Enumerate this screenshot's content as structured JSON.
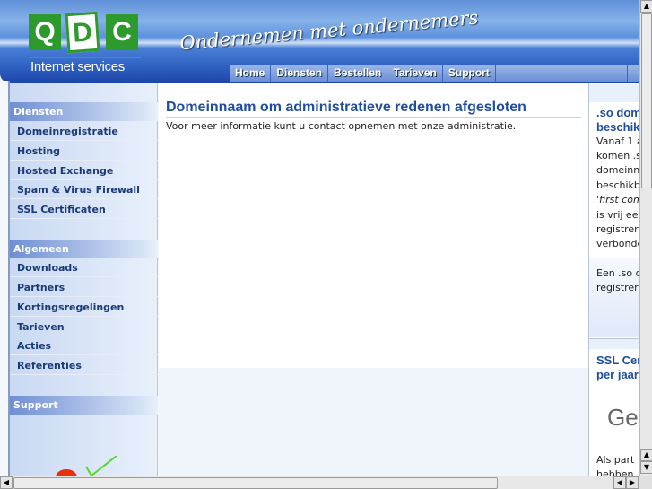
{
  "header": {
    "logo_letters": [
      "Q",
      "D",
      "C"
    ],
    "logo_subtitle": "Internet services",
    "slogan": "Ondernemen met ondernemers"
  },
  "nav": [
    {
      "label": "Home"
    },
    {
      "label": "Diensten"
    },
    {
      "label": "Bestellen"
    },
    {
      "label": "Tarieven"
    },
    {
      "label": "Support"
    }
  ],
  "sidebar": {
    "sections": [
      {
        "title": "Diensten",
        "items": [
          "Domeinregistratie",
          "Hosting",
          "Hosted Exchange",
          "Spam & Virus Firewall",
          "SSL Certificaten"
        ]
      },
      {
        "title": "Algemeen",
        "items": [
          "Downloads",
          "Partners",
          "Kortingsregelingen",
          "Tarieven",
          "Acties",
          "Referenties"
        ]
      },
      {
        "title": "Support",
        "items": []
      }
    ]
  },
  "main": {
    "title": "Domeinnaam om administratieve redenen afgesloten",
    "text": "Voor meer informatie kunt u contact opnemen met onze administratie."
  },
  "right": {
    "box1_title": [
      ".so dom",
      "beschik"
    ],
    "box1_lines": [
      "Vanaf 1 a",
      "komen .so",
      "domeinna",
      "beschikba",
      "'first come",
      "is vrij een",
      "registrere",
      "verbonde"
    ],
    "box1_lines2": [
      "Een .so d",
      "registrere"
    ],
    "box2_title": [
      "SSL Cer",
      "per jaar"
    ],
    "box2_big": "Ge",
    "box2_lines": [
      "Als  part",
      "hebben"
    ]
  },
  "colors": {
    "accent": "#1f4e9e",
    "logo_green": "#2c9a2c"
  }
}
